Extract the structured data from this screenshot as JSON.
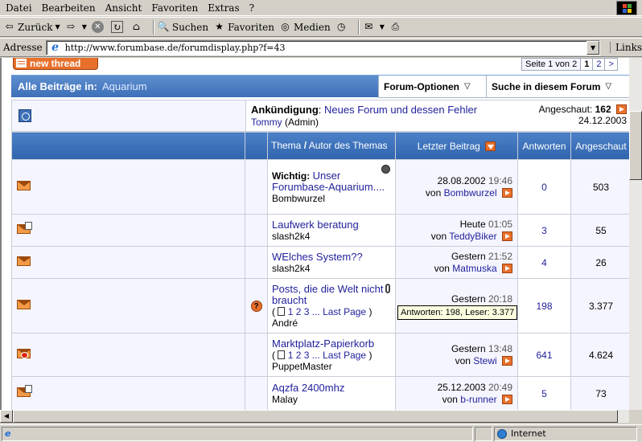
{
  "menu": [
    "Datei",
    "Bearbeiten",
    "Ansicht",
    "Favoriten",
    "Extras",
    "?"
  ],
  "toolbar": {
    "back": "Zurück",
    "search": "Suchen",
    "favorites": "Favoriten",
    "media": "Medien"
  },
  "address": {
    "label": "Adresse",
    "url": "http://www.forumbase.de/forumdisplay.php?f=43",
    "links": "Links"
  },
  "forum": {
    "new_thread": "new thread",
    "pagination": {
      "summary": "Seite 1 von 2",
      "current": "1",
      "next": "2",
      "arrow": ">"
    },
    "header_title": "Alle Beiträge in:",
    "forum_name": "Aquarium",
    "options": "Forum-Optionen",
    "search": "Suche in diesem Forum",
    "announcement": {
      "label": "Ankündigung",
      "title": "Neues Forum und dessen Fehler",
      "author": "Tommy",
      "role": "(Admin)",
      "viewed_label": "Angeschaut:",
      "viewed_count": "162",
      "date": "24.12.2003"
    },
    "columns": {
      "thread": "Thema",
      "slash": "/",
      "author": "Autor des Themas",
      "last_post": "Letzter Beitrag",
      "replies": "Antworten",
      "views": "Angeschaut"
    },
    "threads": [
      {
        "prefix": "Wichtig:",
        "title": "Unser Forumbase-Aquarium....",
        "author": "Bombwurzel",
        "date": "28.08.2002",
        "time": "19:46",
        "by": "von",
        "last_user": "Bombwurzel",
        "replies": "0",
        "views": "503"
      },
      {
        "title": "Laufwerk beratung",
        "author": "slash2k4",
        "date": "Heute",
        "time": "01:05",
        "by": "von",
        "last_user": "TeddyBiker",
        "replies": "3",
        "views": "55"
      },
      {
        "title": "WElches System??",
        "author": "slash2k4",
        "date": "Gestern",
        "time": "21:52",
        "by": "von",
        "last_user": "Matmuska",
        "replies": "4",
        "views": "26"
      },
      {
        "title": "Posts, die die Welt nicht braucht",
        "author": "André",
        "pages_prefix": "(",
        "pages": "1 2 3 ...",
        "last_page": "Last Page",
        "pages_suffix": ")",
        "date": "Gestern",
        "time": "20:18",
        "replies": "198",
        "views": "3.377"
      },
      {
        "title": "Marktplatz-Papierkorb",
        "author": "PuppetMaster",
        "pages_prefix": "(",
        "pages": "1 2 3 ...",
        "last_page": "Last Page",
        "pages_suffix": ")",
        "date": "Gestern",
        "time": "13:48",
        "by": "von",
        "last_user": "Stewi",
        "replies": "641",
        "views": "4.624"
      },
      {
        "title": "Aqzfa 2400mhz",
        "author": "Malay",
        "date": "25.12.2003",
        "time": "20:49",
        "by": "von",
        "last_user": "b-runner",
        "replies": "5",
        "views": "73"
      }
    ],
    "tooltip": "Antworten: 198, Leser: 3.377"
  },
  "status": {
    "zone": "Internet"
  },
  "colors": {
    "header_blue": "#3e70b8",
    "link": "#22229c",
    "accent_orange": "#e8702b"
  }
}
